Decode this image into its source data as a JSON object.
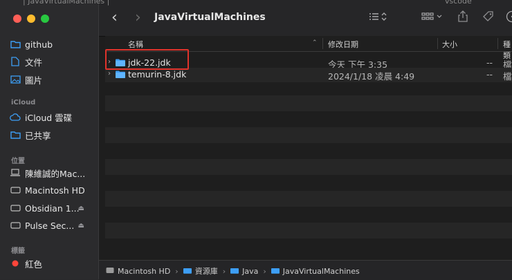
{
  "window": {
    "title": "JavaVirtualMachines"
  },
  "background_text": {
    "left": "| JavaVirtualMachines |",
    "right": "vscode"
  },
  "sidebar": {
    "favorites": [
      {
        "label": "github",
        "icon": "folder-icon"
      },
      {
        "label": "文件",
        "icon": "document-icon"
      },
      {
        "label": "圖片",
        "icon": "photo-icon"
      }
    ],
    "icloud_section": "iCloud",
    "icloud": [
      {
        "label": "iCloud 雲碟",
        "icon": "cloud-icon"
      },
      {
        "label": "已共享",
        "icon": "shared-folder-icon"
      }
    ],
    "locations_section": "位置",
    "locations": [
      {
        "label": "陳維誠的Mac...",
        "icon": "laptop-icon"
      },
      {
        "label": "Macintosh HD",
        "icon": "disk-icon"
      },
      {
        "label": "Obsidian 1...",
        "icon": "disk-icon",
        "eject": "⏏"
      },
      {
        "label": "Pulse Sec...",
        "icon": "disk-icon",
        "eject": "⏏"
      }
    ],
    "tags_section": "標籤",
    "tags": [
      {
        "label": "紅色",
        "color": "#ff453a"
      }
    ]
  },
  "columns": {
    "name": "名稱",
    "date": "修改日期",
    "size": "大小",
    "kind": "種類"
  },
  "files": [
    {
      "name": "jdk-22.jdk",
      "date": "今天 下午 3:35",
      "size": "--",
      "kind": "檔案夾"
    },
    {
      "name": "temurin-8.jdk",
      "date": "2024/1/18 凌晨 4:49",
      "size": "--",
      "kind": "檔案夾"
    }
  ],
  "pathbar": {
    "crumbs": [
      "Macintosh HD",
      "資源庫",
      "Java",
      "JavaVirtualMachines"
    ]
  },
  "colors": {
    "folder": "#3d9ef5",
    "highlight": "#e0332b"
  }
}
